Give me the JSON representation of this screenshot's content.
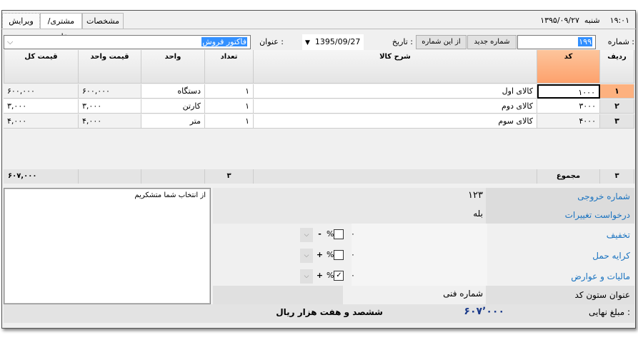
{
  "tabs": [
    {
      "label": "ویرایش",
      "selected": true
    },
    {
      "label": "مشتری/متقاضی"
    },
    {
      "label": "مشخصات"
    }
  ],
  "header": {
    "time": "۱۹:۰۱",
    "day": "شنبه",
    "date": "۱۳۹۵/۰۹/۲۷"
  },
  "form": {
    "number_label": "شماره :",
    "number_value": "۱۹۹",
    "new_number_button": "شماره جدید",
    "from_number_button": "از این شماره",
    "date_label": "تاریخ :",
    "date_value": "1395/09/27",
    "title_label": "عنوان :",
    "title_value": "فاکتور فروش"
  },
  "grid": {
    "columns": [
      "ردیف",
      "کد",
      "شرح کالا",
      "تعداد",
      "واحد",
      "قیمت واحد",
      "قیمت کل"
    ],
    "rows": [
      {
        "row": "۱",
        "code": "۱۰۰۰",
        "desc": "کالای اول",
        "qty": "۱",
        "unit": "دستگاه",
        "unit_price": "۶۰۰,۰۰۰",
        "total": "۶۰۰,۰۰۰"
      },
      {
        "row": "۲",
        "code": "۳۰۰۰",
        "desc": "کالای دوم",
        "qty": "۱",
        "unit": "کارتن",
        "unit_price": "۳,۰۰۰",
        "total": "۳,۰۰۰"
      },
      {
        "row": "۳",
        "code": "۴۰۰۰",
        "desc": "کالای سوم",
        "qty": "۱",
        "unit": "متر",
        "unit_price": "۴,۰۰۰",
        "total": "۴,۰۰۰"
      }
    ],
    "totals": {
      "count": "۳",
      "label": "مجموع",
      "qty": "۳",
      "total": "۶۰۷,۰۰۰"
    }
  },
  "note": "از انتخاب شما متشکریم",
  "details": {
    "output_number_label": "شماره خروجی",
    "output_number": "۱۲۳",
    "change_request_label": "درخواست تغییرات",
    "change_request": "بله",
    "discount_label": "تخفیف",
    "discount_value": "۰",
    "discount_sign": "-",
    "discount_percent": false,
    "freight_label": "کرایه حمل",
    "freight_value": "۰",
    "freight_sign": "+",
    "freight_percent": false,
    "tax_label": "مالیات و عوارض",
    "tax_value": "۰",
    "tax_sign": "+",
    "tax_percent": true,
    "percent_symbol": "%",
    "code_column_label": "عنوان ستون کد",
    "code_column_value": "شماره فنی"
  },
  "final": {
    "label": "مبلغ نهایی :",
    "amount": "۶۰۷٬۰۰۰",
    "words": "ششصد و هفت هزار  ریال"
  },
  "colors": {
    "accent_orange": "#fdb17f",
    "link_blue": "#1a73c0",
    "selection": "#3390ff"
  }
}
